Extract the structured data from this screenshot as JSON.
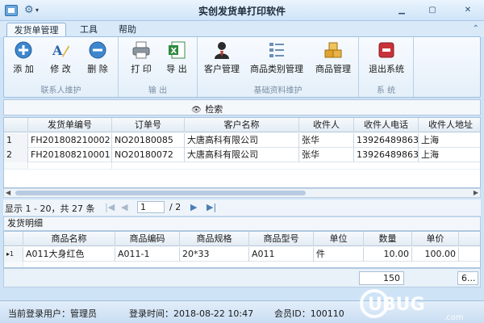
{
  "window": {
    "title": "实创发货单打印软件"
  },
  "ribbon_tabs": [
    "发货单管理",
    "工具",
    "帮助"
  ],
  "ribbon": {
    "groups": [
      {
        "label": "联系人维护",
        "buttons": [
          "添 加",
          "修 改",
          "删 除"
        ]
      },
      {
        "label": "输 出",
        "buttons": [
          "打 印",
          "导 出"
        ]
      },
      {
        "label": "基础资料维护",
        "buttons": [
          "客户管理",
          "商品类别管理",
          "商品管理"
        ]
      },
      {
        "label": "系 统",
        "buttons": [
          "退出系统"
        ]
      }
    ]
  },
  "search": {
    "label": "检索"
  },
  "upper_grid": {
    "columns": [
      "发货单编号",
      "订单号",
      "客户名称",
      "收件人",
      "收件人电话",
      "收件人地址"
    ],
    "rows": [
      {
        "index": "1",
        "cells": [
          "FH201808210002",
          "NO20180085",
          "大唐高科有限公司",
          "张华",
          "13926489863",
          "上海"
        ]
      },
      {
        "index": "2",
        "cells": [
          "FH201808210001",
          "NO20180072",
          "大唐高科有限公司",
          "张华",
          "13926489863",
          "上海"
        ]
      }
    ]
  },
  "pager": {
    "summary": "显示 1 - 20，共 27 条",
    "current_page": "1",
    "total_pages": "/ 2"
  },
  "detail": {
    "title": "发货明细",
    "columns": [
      "商品名称",
      "商品编码",
      "商品规格",
      "商品型号",
      "单位",
      "数量",
      "单价"
    ],
    "rows": [
      {
        "cells": [
          "A011大身红色",
          "A011-1",
          "20*33",
          "A011",
          "件",
          "10.00",
          "100.00"
        ]
      }
    ],
    "total_quantity": "150",
    "total_amount": "6..."
  },
  "status": {
    "user": "当前登录用户：管理员",
    "login_time": "登录时间：2018-08-22 10:47",
    "member_id": "会员ID：100110"
  },
  "watermark": {
    "text": "UBUG",
    "sub": ".com"
  },
  "colors": {
    "ribbon_bg": "#e4eff9",
    "selection": "#cfe4f8",
    "accent": "#2f6ea8"
  }
}
